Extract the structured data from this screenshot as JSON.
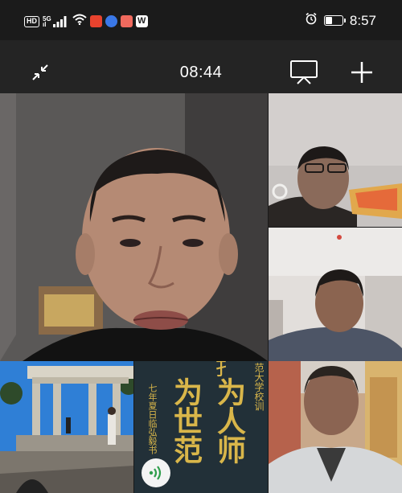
{
  "status_bar": {
    "hd_label": "HD",
    "network_label": "5G",
    "network_sub": "ıl",
    "time": "8:57",
    "battery_level": 0.4,
    "icons": [
      "hd-icon",
      "cellular-signal-icon",
      "wifi-icon",
      "notification-app-icon",
      "shield-app-icon",
      "mail-app-icon",
      "w-app-icon",
      "alarm-icon",
      "battery-icon"
    ]
  },
  "toolbar": {
    "meeting_timer": "08:44",
    "icons": [
      "collapse-icon",
      "screen-share-icon",
      "add-icon"
    ]
  },
  "participants": [
    {
      "id": "main-speaker",
      "type": "camera"
    },
    {
      "id": "participant-2",
      "type": "camera"
    },
    {
      "id": "participant-3",
      "type": "camera"
    },
    {
      "id": "participant-4",
      "type": "landmark-photo"
    },
    {
      "id": "participant-5",
      "type": "calligraphy"
    },
    {
      "id": "participant-6",
      "type": "camera"
    }
  ],
  "calligraphy": {
    "side_text": "范大学校训",
    "left_column": "七年夏日临弘毅书",
    "column_a": "为世范",
    "column_b": "为人师",
    "top_partial": "扌"
  },
  "colors": {
    "status_bg": "#1b1b1b",
    "toolbar_bg": "#242424",
    "calligraphy_gold": "#d9b64a",
    "audio_green": "#2f9e4c"
  }
}
